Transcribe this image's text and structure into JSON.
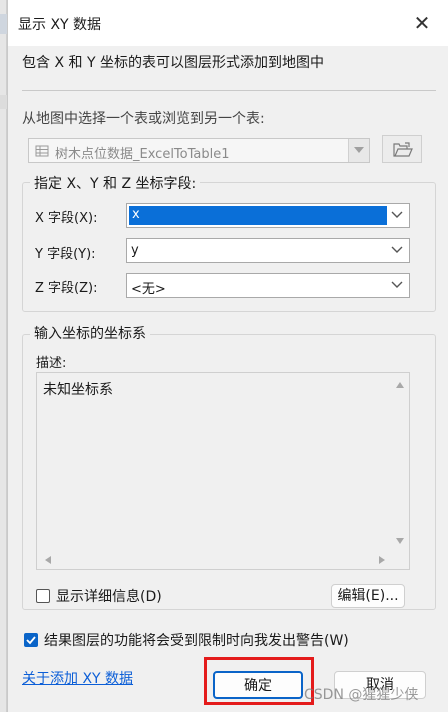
{
  "window": {
    "title": "显示 XY 数据"
  },
  "description": "包含 X 和 Y 坐标的表可以图层形式添加到地图中",
  "table_select": {
    "label": "从地图中选择一个表或浏览到另一个表:",
    "value": "树木点位数据_ExcelToTable1"
  },
  "fields_group": {
    "title": "指定 X、Y 和 Z 坐标字段:",
    "x_label": "X 字段(X):",
    "x_value": "x",
    "y_label": "Y 字段(Y):",
    "y_value": "y",
    "z_label": "Z 字段(Z):",
    "z_value": "<无>"
  },
  "coord_group": {
    "title": "输入坐标的坐标系",
    "desc_label": "描述:",
    "desc_value": "未知坐标系",
    "show_details_label": "显示详细信息(D)",
    "show_details_checked": false,
    "edit_label": "编辑(E)..."
  },
  "warning": {
    "label": "结果图层的功能将会受到限制时向我发出警告(W)",
    "checked": true
  },
  "about_link": "关于添加 XY 数据",
  "ok_label": "确定",
  "cancel_label": "取消",
  "watermark": "CSDN @猩猩少侠",
  "colors": {
    "accent": "#0a64c8",
    "highlight": "#e41b1b",
    "link": "#0b5ed7"
  }
}
